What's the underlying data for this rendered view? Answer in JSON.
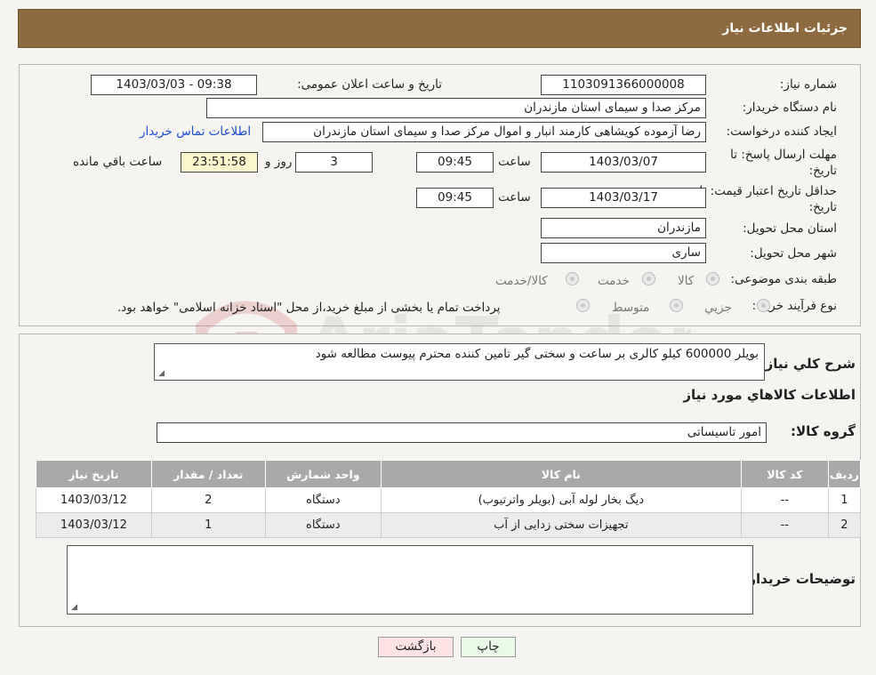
{
  "header": {
    "title": "جزئیات اطلاعات نیاز"
  },
  "watermark": {
    "text": "AriaTender.neT"
  },
  "info": {
    "need_number_label": "شماره نیاز:",
    "need_number": "1103091366000008",
    "announce_label": "تاریخ و ساعت اعلان عمومی:",
    "announce_value": "1403/03/03 - 09:38",
    "buyer_org_label": "نام دستگاه خریدار:",
    "buyer_org": "مرکز صدا و سیمای استان مازندران",
    "creator_label": "ایجاد کننده درخواست:",
    "creator": "رضا آزموده کویشاهی کارمند انبار و اموال مرکز صدا و سیمای استان مازندران",
    "contact_link": "اطلاعات تماس خریدار",
    "deadline_label_1": "مهلت ارسال پاسخ: تا",
    "deadline_label_2": "تاریخ:",
    "deadline_date": "1403/03/07",
    "time_label": "ساعت",
    "deadline_time": "09:45",
    "days_value": "3",
    "days_label": "روز و",
    "remaining_value": "23:51:58",
    "remaining_label": "ساعت باقي مانده",
    "validity_label_1": "حداقل تاریخ اعتبار قیمت: تا",
    "validity_label_2": "تاریخ:",
    "validity_date": "1403/03/17",
    "validity_time": "09:45",
    "province_label": "استان محل تحویل:",
    "province": "مازندران",
    "city_label": "شهر محل تحویل:",
    "city": "ساری",
    "category_label": "طبقه بندی موضوعی:",
    "category_options": [
      "کالا",
      "خدمت",
      "کالا/خدمت"
    ],
    "purchase_type_label": "نوع فرآیند خرید :",
    "purchase_options": [
      "جزیي",
      "متوسط"
    ],
    "purchase_note": "پرداخت تمام یا بخشی از مبلغ خرید،از محل \"اسناد خزانه اسلامی\" خواهد بود."
  },
  "details": {
    "summary_label": "شرح کلي نياز:",
    "summary": "بویلر 600000 کیلو کالری بر ساعت و سختی گیر تامین کننده محترم پیوست مطالعه شود",
    "goods_info_title": "اطلاعات کالاهاي مورد نياز",
    "group_label": "گروه کالا:",
    "group": "امور تاسیساتی",
    "table": {
      "headers": [
        "رديف",
        "کد کالا",
        "نام کالا",
        "واحد شمارش",
        "تعداد / مقدار",
        "تاریخ نیاز"
      ],
      "rows": [
        [
          "1",
          "--",
          "دیگ بخار لوله آبی (بویلر واترتیوب)",
          "دستگاه",
          "2",
          "1403/03/12"
        ],
        [
          "2",
          "--",
          "تجهیزات سختی زدایی از آب",
          "دستگاه",
          "1",
          "1403/03/12"
        ]
      ]
    },
    "buyer_notes_label": "توضیحات خریدار:",
    "buyer_notes": ""
  },
  "buttons": {
    "print": "چاپ",
    "back": "بازگشت"
  },
  "colors": {
    "header_bg": "#8d6a3f",
    "timer_bg": "#fbf7cc",
    "table_header_bg": "#a9a9a9",
    "link": "#1a4fd0",
    "back_btn_bg": "#fde3e3",
    "print_btn_bg": "#e9fbe6"
  }
}
